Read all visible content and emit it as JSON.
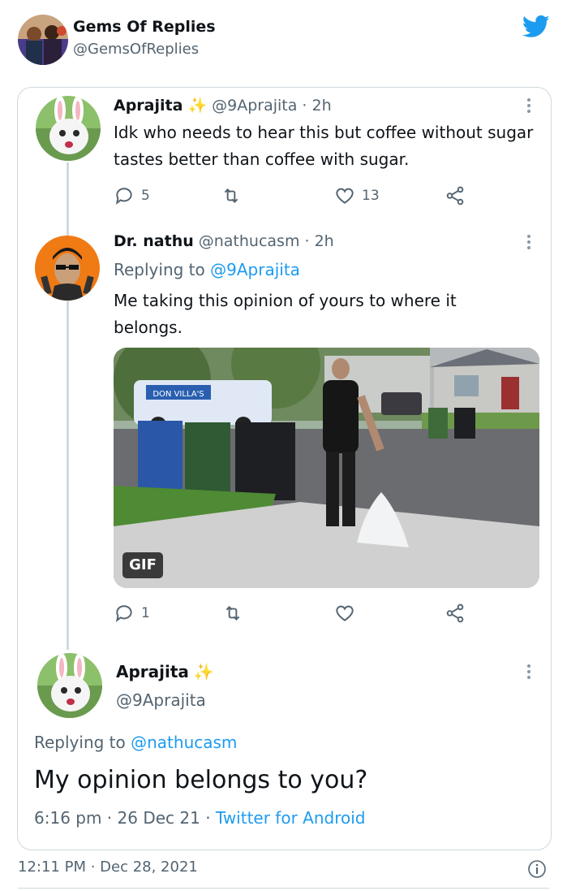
{
  "outer": {
    "name": "Gems Of Replies",
    "handle": "@GemsOfReplies",
    "timestamp": "12:11 PM · Dec 28, 2021"
  },
  "tweet1": {
    "name": "Aprajita",
    "name_emoji": "✨",
    "handle_time": "@9Aprajita · 2h",
    "text": "Idk who needs to hear this but coffee without sugar tastes better than coffee with sugar.",
    "replies": "5",
    "likes": "13"
  },
  "tweet2": {
    "name": "Dr. nathu",
    "handle_time": "@nathucasm · 2h",
    "replying_prefix": "Replying to",
    "replying_to": "@9Aprajita",
    "text": "Me taking this opinion of yours to where it belongs.",
    "media_badge": "GIF",
    "van_text": "DON VILLA'S",
    "replies": "1"
  },
  "tweet3": {
    "name": "Aprajita",
    "name_emoji": "✨",
    "handle": "@9Aprajita",
    "replying_prefix": "Replying to",
    "replying_to": "@nathucasm",
    "text": "My opinion belongs to you?",
    "time": "6:16 pm · 26 Dec 21",
    "separator": "·",
    "source": "Twitter for Android"
  },
  "colors": {
    "accent": "#1d9bf0",
    "muted": "#536471",
    "border": "#cfd9de"
  }
}
